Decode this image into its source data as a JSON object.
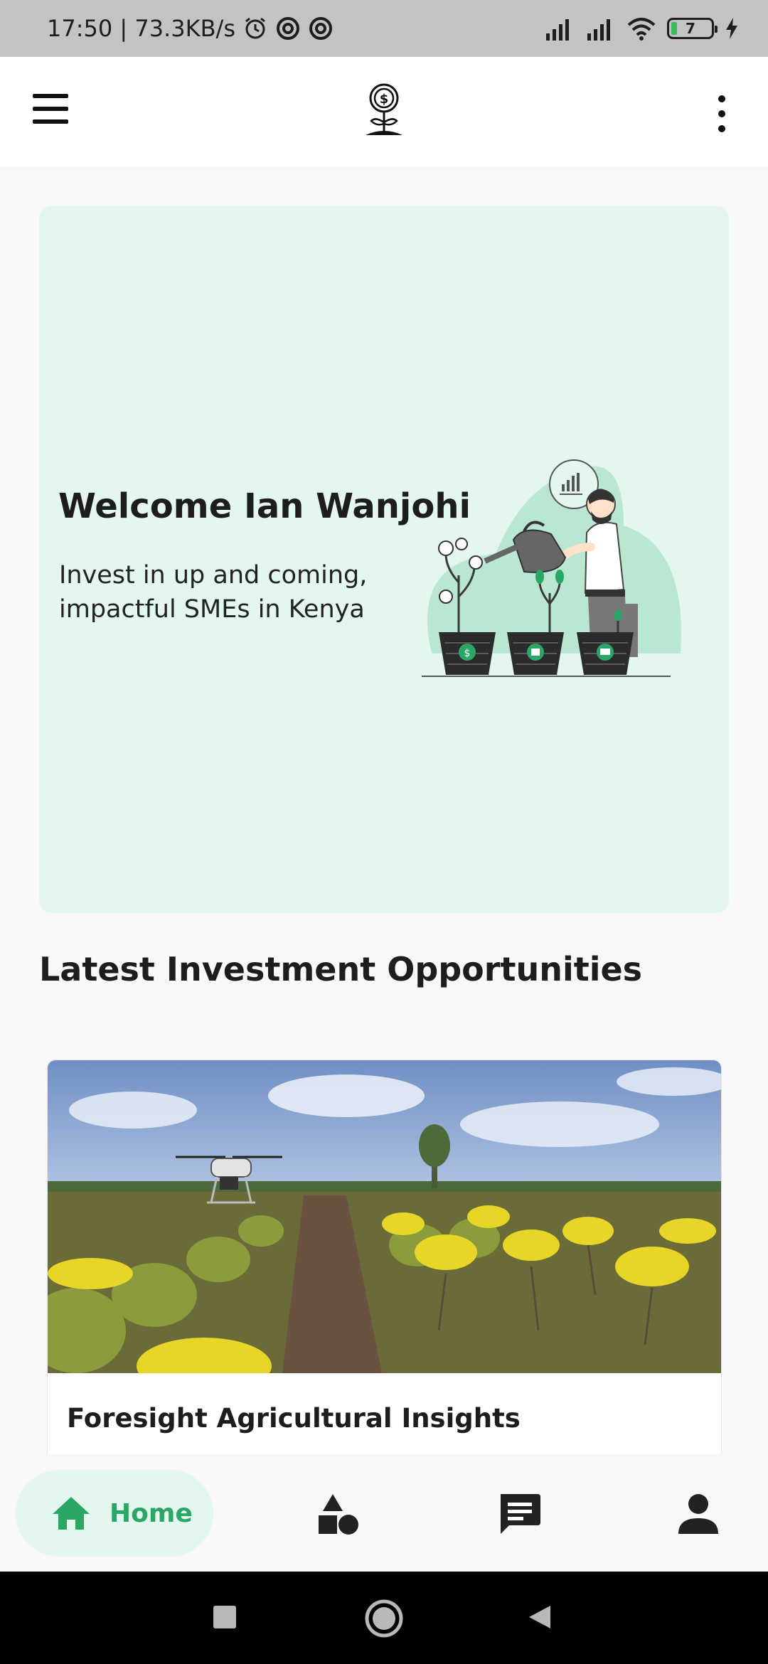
{
  "status_bar": {
    "time_speed": "17:50 | 73.3KB/s",
    "battery_level": "7"
  },
  "app_bar": {
    "menu_icon": "hamburger-menu-icon",
    "logo_icon": "plant-coin-logo-icon",
    "overflow_icon": "more-vertical-icon"
  },
  "hero": {
    "title": "Welcome Ian Wanjohi",
    "subtitle": "Invest in up and coming, impactful SMEs in Kenya",
    "illustration": "man-watering-money-plants-illustration"
  },
  "opportunities": {
    "section_title": "Latest Investment Opportunities",
    "items": [
      {
        "title": "Foresight Agricultural Insights",
        "image": "drone-over-flower-farm-photo"
      }
    ]
  },
  "bottom_nav": {
    "items": [
      {
        "label": "Home",
        "icon": "home-icon",
        "active": true
      },
      {
        "label": "",
        "icon": "shapes-icon",
        "active": false
      },
      {
        "label": "",
        "icon": "chat-icon",
        "active": false
      },
      {
        "label": "",
        "icon": "person-icon",
        "active": false
      }
    ]
  },
  "colors": {
    "accent_green": "#2aa765",
    "hero_background": "#e3f7ee",
    "status_bar": "#c3c3c3",
    "page_background": "#f8f8f8"
  }
}
